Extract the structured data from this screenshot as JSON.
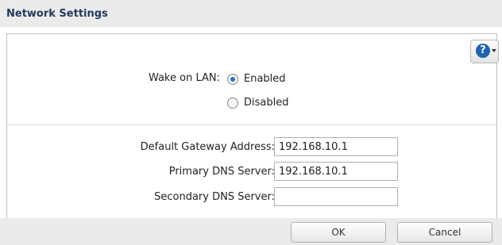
{
  "header": {
    "title": "Network Settings"
  },
  "help": {
    "glyph": "?",
    "icon": "help-icon"
  },
  "wake_on_lan": {
    "label": "Wake on LAN:",
    "options": [
      {
        "label": "Enabled",
        "checked": true
      },
      {
        "label": "Disabled",
        "checked": false
      }
    ]
  },
  "fields": {
    "gateway": {
      "label": "Default Gateway Address:",
      "value": "192.168.10.1"
    },
    "primary_dns": {
      "label": "Primary DNS Server:",
      "value": "192.168.10.1"
    },
    "secondary_dns": {
      "label": "Secondary DNS Server:",
      "value": ""
    }
  },
  "footer": {
    "ok_label": "OK",
    "cancel_label": "Cancel"
  },
  "colors": {
    "accent": "#1f63b3",
    "title": "#233a5c",
    "bar": "#ebebeb"
  }
}
